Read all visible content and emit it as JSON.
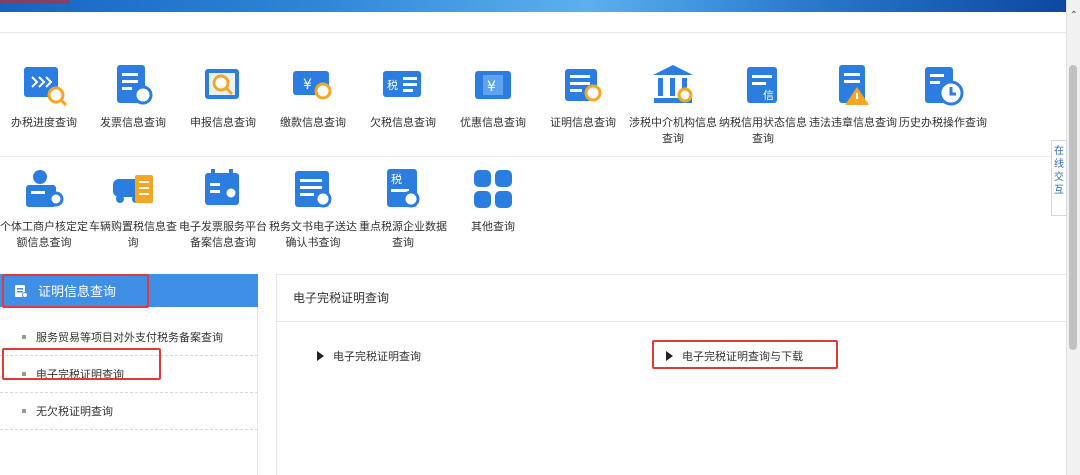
{
  "banner": {
    "color_primary": "#2f86d8",
    "color_accent": "#c62828"
  },
  "icon_row_1": [
    {
      "label": "办税进度查询",
      "icon": "progress-search-icon"
    },
    {
      "label": "发票信息查询",
      "icon": "invoice-search-icon"
    },
    {
      "label": "申报信息查询",
      "icon": "declaration-search-icon"
    },
    {
      "label": "缴款信息查询",
      "icon": "payment-search-icon"
    },
    {
      "label": "欠税信息查询",
      "icon": "tax-arrears-icon"
    },
    {
      "label": "优惠信息查询",
      "icon": "tax-preference-icon"
    },
    {
      "label": "证明信息查询",
      "icon": "certificate-search-icon"
    },
    {
      "label": "涉税中介机构信息查询",
      "icon": "intermediary-institution-icon"
    },
    {
      "label": "纳税信用状态信息查询",
      "icon": "credit-status-icon"
    },
    {
      "label": "违法违章信息查询",
      "icon": "violation-warning-icon"
    },
    {
      "label": "历史办税操作查询",
      "icon": "history-clock-icon"
    }
  ],
  "icon_row_2": [
    {
      "label": "个体工商户核定定额信息查询",
      "icon": "individual-business-icon"
    },
    {
      "label": "车辆购置税信息查询",
      "icon": "vehicle-tax-icon"
    },
    {
      "label": "电子发票服务平台备案信息查询",
      "icon": "e-invoice-platform-icon"
    },
    {
      "label": "税务文书电子送达确认书查询",
      "icon": "tax-document-icon"
    },
    {
      "label": "重点税源企业数据查询",
      "icon": "key-tax-source-icon"
    },
    {
      "label": "其他查询",
      "icon": "other-grid-icon"
    }
  ],
  "side_tab": {
    "label": "在线交互"
  },
  "sidebar": {
    "header": "证明信息查询",
    "items": [
      {
        "label": "服务贸易等项目对外支付税务备案查询"
      },
      {
        "label": "电子完税证明查询"
      },
      {
        "label": "无欠税证明查询"
      }
    ]
  },
  "main": {
    "title": "电子完税证明查询",
    "links": [
      {
        "label": "电子完税证明查询"
      },
      {
        "label": "电子完税证明查询与下载"
      }
    ]
  },
  "colors": {
    "sidebar_header": "#3f8fe6",
    "highlight_box": "#e53935",
    "icon_blue": "#2b7de0",
    "icon_orange": "#f5a623"
  }
}
